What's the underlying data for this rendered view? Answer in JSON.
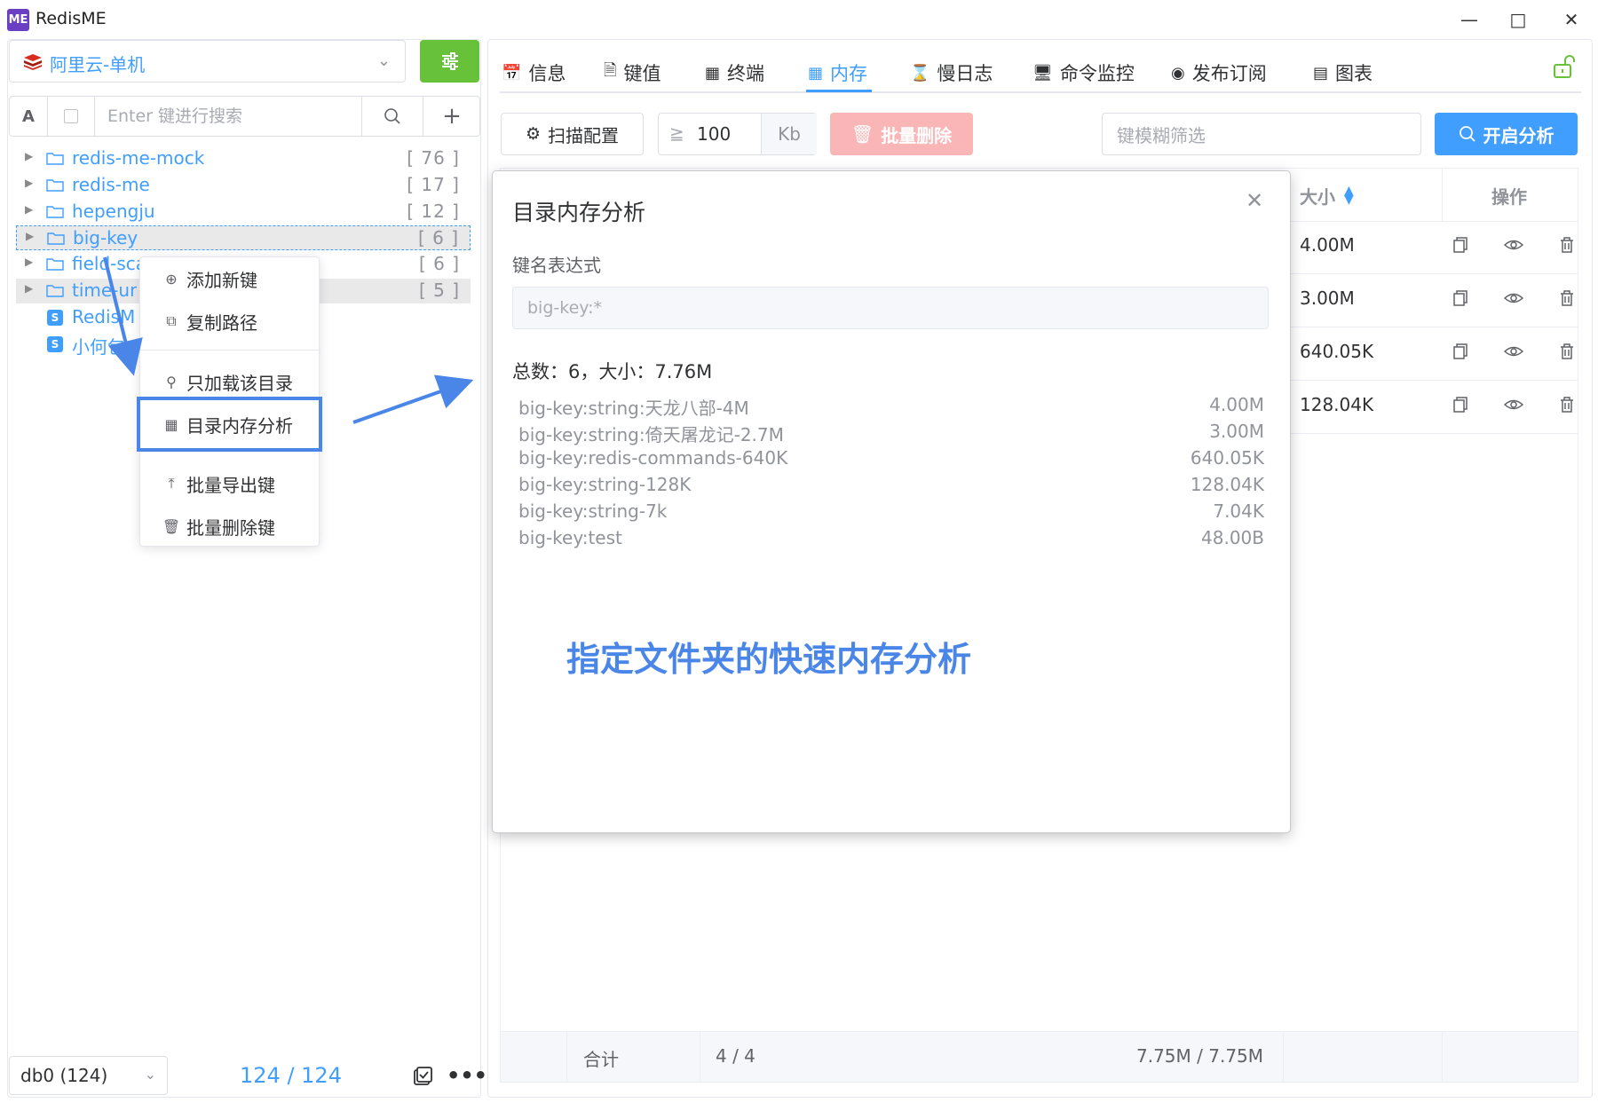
{
  "app": {
    "logo_text": "ME",
    "title": "RedisME",
    "window_controls": [
      "minimize-icon",
      "maximize-icon",
      "close-icon"
    ]
  },
  "sidebar": {
    "connection": "阿里云-单机",
    "search_placeholder": "Enter 键进行搜索",
    "type_toggle": "A",
    "tree": [
      {
        "name": "redis-me-mock",
        "count": "[ 76 ]",
        "type": "folder"
      },
      {
        "name": "redis-me",
        "count": "[ 17 ]",
        "type": "folder"
      },
      {
        "name": "hepengju",
        "count": "[ 12 ]",
        "type": "folder"
      },
      {
        "name": "big-key",
        "count": "[ 6 ]",
        "type": "folder",
        "selected": true
      },
      {
        "name": "field-sca",
        "count": "[ 6 ]",
        "type": "folder"
      },
      {
        "name": "time-ur",
        "count": "[ 5 ]",
        "type": "folder"
      },
      {
        "name": "RedisM",
        "type": "string"
      },
      {
        "name": "小何包",
        "type": "string"
      }
    ],
    "db": "db0 (124)",
    "key_count": "124 / 124"
  },
  "context_menu": {
    "items": [
      {
        "label": "添加新键",
        "icon": "plus-circle-icon"
      },
      {
        "label": "复制路径",
        "icon": "copy-icon"
      },
      {
        "label": "只加载该目录",
        "icon": "search-icon"
      },
      {
        "label": "目录内存分析",
        "icon": "table-icon"
      },
      {
        "label": "批量导出键",
        "icon": "upload-icon"
      },
      {
        "label": "批量删除键",
        "icon": "trash-icon"
      }
    ]
  },
  "tabs": [
    {
      "label": "信息",
      "icon": "calendar-icon"
    },
    {
      "label": "键值",
      "icon": "document-icon"
    },
    {
      "label": "终端",
      "icon": "terminal-icon"
    },
    {
      "label": "内存",
      "icon": "table-icon",
      "active": true
    },
    {
      "label": "慢日志",
      "icon": "hourglass-icon"
    },
    {
      "label": "命令监控",
      "icon": "monitor-icon"
    },
    {
      "label": "发布订阅",
      "icon": "broadcast-icon"
    },
    {
      "label": "图表",
      "icon": "chart-icon"
    }
  ],
  "toolbar": {
    "scan_label": "扫描配置",
    "ge_symbol": "≧",
    "size_value": "100",
    "size_unit": "Kb",
    "batch_delete_label": "批量删除",
    "fuzzy_placeholder": "键模糊筛选",
    "analyze_label": "开启分析"
  },
  "table": {
    "col_size": "大小",
    "col_ops": "操作",
    "rows": [
      {
        "size": "4.00M"
      },
      {
        "size": "3.00M"
      },
      {
        "size": "640.05K"
      },
      {
        "size": "128.04K"
      }
    ],
    "footer": {
      "label": "合计",
      "count": "4 / 4",
      "size": "7.75M / 7.75M"
    }
  },
  "modal": {
    "title": "目录内存分析",
    "expr_label": "键名表达式",
    "expr_placeholder": "big-key:*",
    "summary": "总数：6，大小：7.76M",
    "keys": [
      {
        "key": "big-key:string:天龙八部-4M",
        "size": "4.00M"
      },
      {
        "key": "big-key:string:倚天屠龙记-2.7M",
        "size": "3.00M"
      },
      {
        "key": "big-key:redis-commands-640K",
        "size": "640.05K"
      },
      {
        "key": "big-key:string-128K",
        "size": "128.04K"
      },
      {
        "key": "big-key:string-7k",
        "size": "7.04K"
      },
      {
        "key": "big-key:test",
        "size": "48.00B"
      }
    ]
  },
  "annotation": {
    "caption": "指定文件夹的快速内存分析",
    "color": "#4a86e8"
  },
  "colors": {
    "primary": "#409eff",
    "success": "#67c23a",
    "danger_light": "#fab6b6"
  }
}
